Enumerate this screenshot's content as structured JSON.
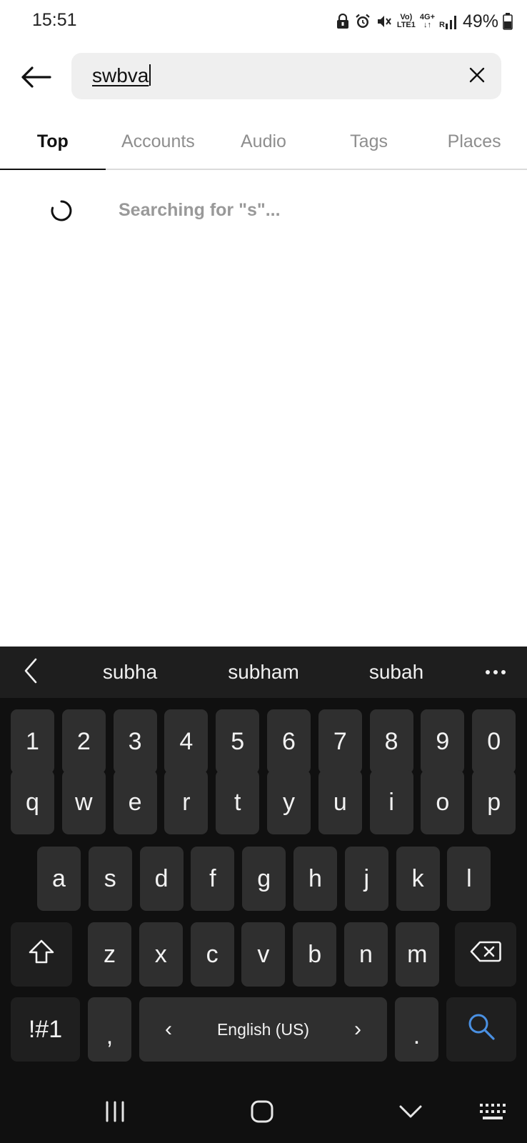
{
  "status_bar": {
    "time": "15:51",
    "network_top": "Vo)",
    "network_bottom": "LTE1",
    "signal_label": "4G+",
    "roaming": "R",
    "battery_percent": "49%"
  },
  "search": {
    "value": "swbva"
  },
  "tabs": [
    {
      "label": "Top",
      "active": true
    },
    {
      "label": "Accounts",
      "active": false
    },
    {
      "label": "Audio",
      "active": false
    },
    {
      "label": "Tags",
      "active": false
    },
    {
      "label": "Places",
      "active": false
    }
  ],
  "results": {
    "searching_text": "Searching for \"s\"..."
  },
  "keyboard": {
    "suggestions": [
      "subha",
      "subham",
      "subah"
    ],
    "number_row": [
      "1",
      "2",
      "3",
      "4",
      "5",
      "6",
      "7",
      "8",
      "9",
      "0"
    ],
    "row1": [
      "q",
      "w",
      "e",
      "r",
      "t",
      "y",
      "u",
      "i",
      "o",
      "p"
    ],
    "row2": [
      "a",
      "s",
      "d",
      "f",
      "g",
      "h",
      "j",
      "k",
      "l"
    ],
    "row3": [
      "z",
      "x",
      "c",
      "v",
      "b",
      "n",
      "m"
    ],
    "symbols_label": "!#1",
    "comma_label": ",",
    "space_label": "English (US)",
    "space_left_arrow": "‹",
    "space_right_arrow": "›",
    "period_label": ".",
    "search_key_color": "#4a90e2"
  },
  "icons": {
    "back": "arrow-left-icon",
    "clear": "close-icon",
    "spinner": "loading-spinner-icon",
    "shift": "shift-icon",
    "backspace": "backspace-icon",
    "search": "search-icon",
    "recents": "recent-apps-icon",
    "home": "home-icon",
    "hide_keyboard": "chevron-down-icon",
    "keyboard_switch": "keyboard-icon"
  }
}
